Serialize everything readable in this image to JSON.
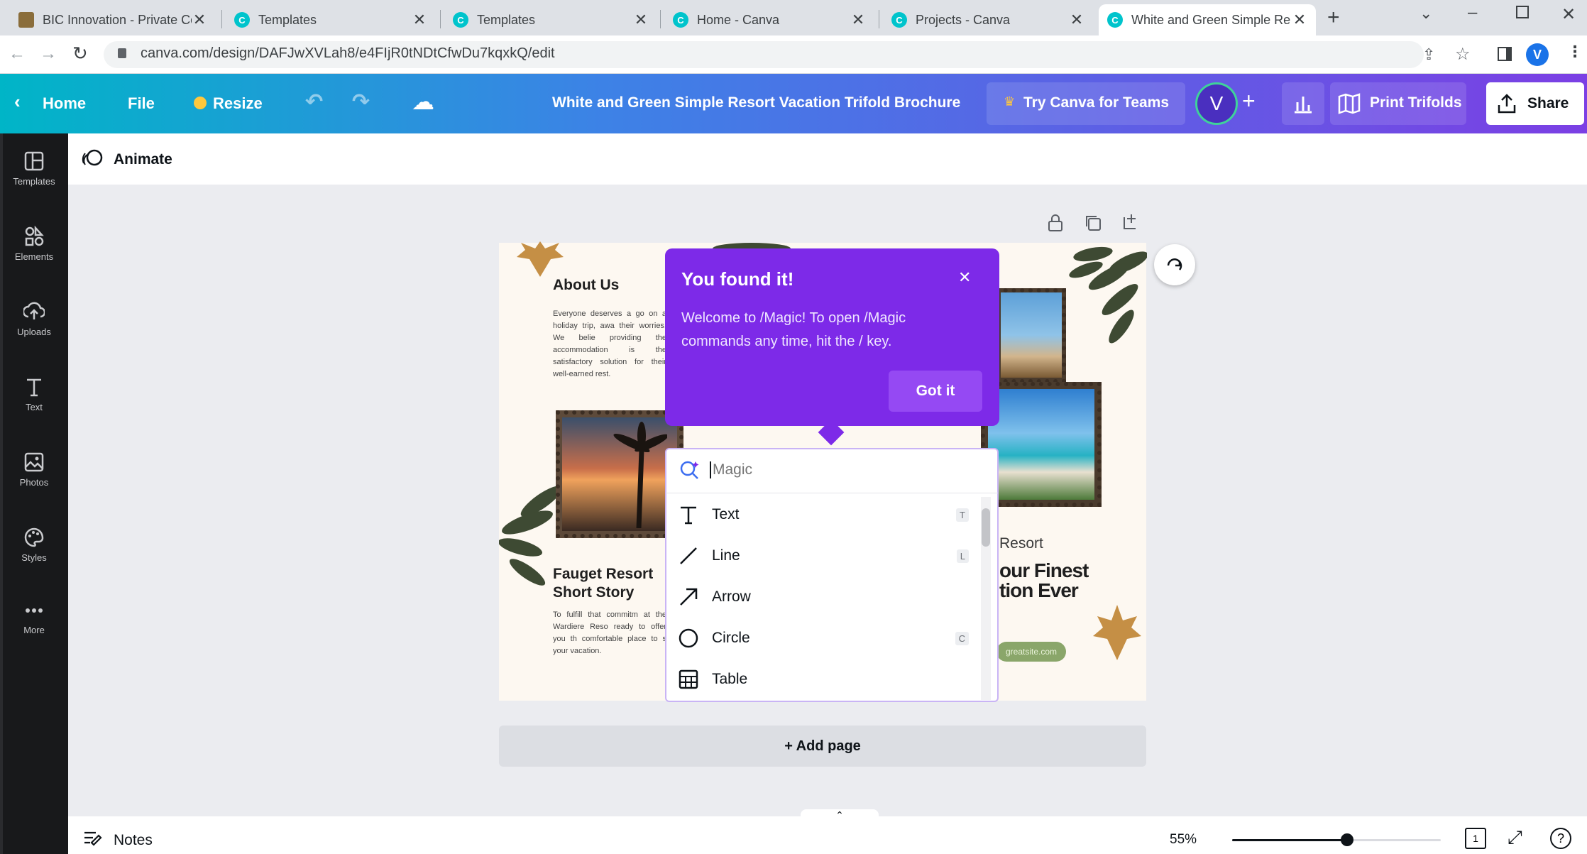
{
  "browser": {
    "tabs": [
      {
        "title": "BIC Innovation - Private Co",
        "active": false
      },
      {
        "title": "Templates",
        "active": false
      },
      {
        "title": "Templates",
        "active": false
      },
      {
        "title": "Home - Canva",
        "active": false
      },
      {
        "title": "Projects - Canva",
        "active": false
      },
      {
        "title": "White and Green Simple Re",
        "active": true
      }
    ],
    "url": "canva.com/design/DAFJwXVLah8/e4FIjR0tNDtCfwDu7kqxkQ/edit",
    "profile": "V"
  },
  "header": {
    "home": "Home",
    "file": "File",
    "resize": "Resize",
    "title": "White and Green Simple Resort Vacation Trifold Brochure",
    "try_teams": "Try Canva for Teams",
    "avatar": "V",
    "print": "Print Trifolds",
    "share": "Share"
  },
  "rail": [
    "Templates",
    "Elements",
    "Uploads",
    "Text",
    "Photos",
    "Styles",
    "More"
  ],
  "toolbar": {
    "animate": "Animate"
  },
  "design": {
    "about_title": "About Us",
    "about_body": "Everyone deserves a go on a holiday trip, awa their worries. We belie providing the accommodation is the satisfactory solution for their well-earned rest.",
    "story_title": "Fauget Resort Short Story",
    "story_body": "To fulfill that commitm at the Wardiere Reso ready to offer you th comfortable place to s your vacation.",
    "resort": "Resort",
    "finest": "our Finest tion Ever",
    "site": "greatsite.com"
  },
  "popup": {
    "title": "You found it!",
    "body": "Welcome to /Magic! To open /Magic commands any time, hit the / key.",
    "button": "Got it"
  },
  "magic": {
    "placeholder": "Magic",
    "items": [
      {
        "label": "Text",
        "key": "T"
      },
      {
        "label": "Line",
        "key": "L"
      },
      {
        "label": "Arrow",
        "key": ""
      },
      {
        "label": "Circle",
        "key": "C"
      },
      {
        "label": "Table",
        "key": ""
      }
    ]
  },
  "add_page": "+ Add page",
  "footer": {
    "notes": "Notes",
    "zoom": "55%",
    "zoom_fraction": 0.55,
    "page": "1"
  },
  "colors": {
    "purple": "#7d2ae8",
    "header_start": "#00b5c7",
    "header_end": "#7b3fe4",
    "rail": "#18191b",
    "leaf": "#3e4a33"
  }
}
